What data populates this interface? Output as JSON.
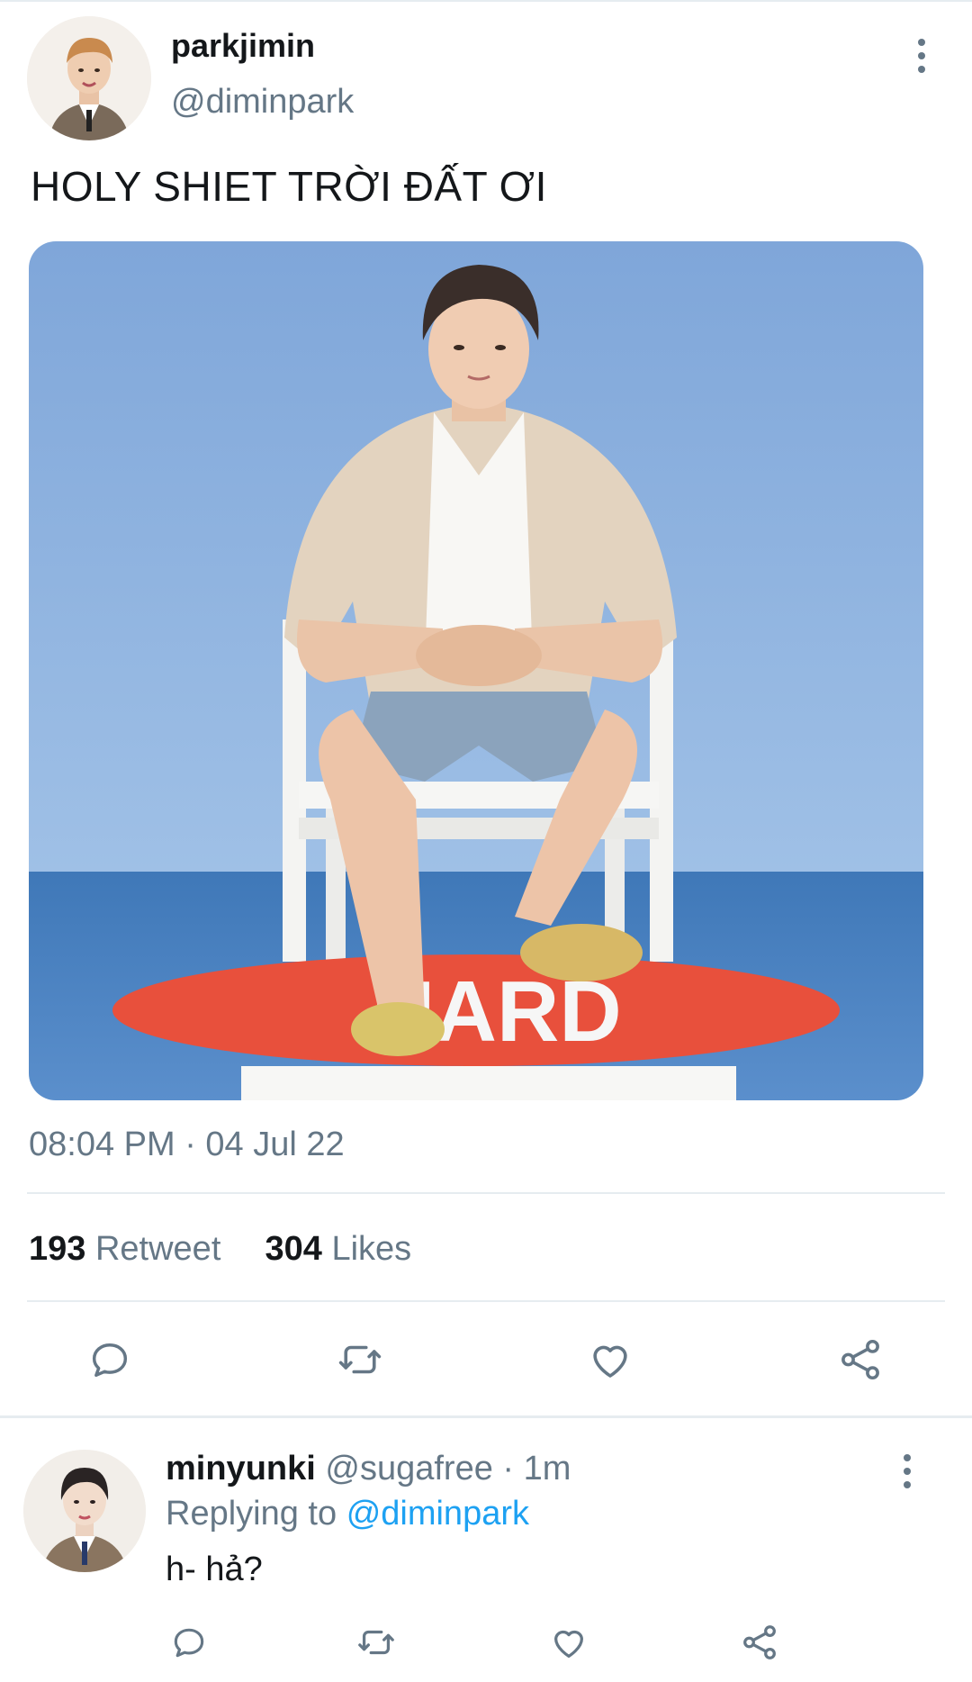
{
  "tweet": {
    "display_name": "parkjimin",
    "handle": "@diminpark",
    "text": "HOLY SHIET TRỜI ĐẤT ƠI",
    "timestamp": "08:04 PM · 04 Jul 22",
    "photo_text": "UARD",
    "stats": {
      "retweets_count": "193",
      "retweets_label": "Retweet",
      "likes_count": "304",
      "likes_label": "Likes"
    },
    "actions": [
      "reply-icon",
      "retweet-icon",
      "like-icon",
      "share-icon"
    ]
  },
  "reply": {
    "display_name": "minyunki",
    "meta": "@sugafree · 1m",
    "replying_prefix": "Replying to",
    "replying_to": "@diminpark",
    "text": "h- hả?",
    "actions": [
      "reply-icon",
      "retweet-icon",
      "like-icon",
      "share-icon"
    ]
  },
  "colors": {
    "text_primary": "#14171a",
    "text_secondary": "#657786",
    "link": "#1da1f2",
    "divider": "#e6ecf0"
  }
}
